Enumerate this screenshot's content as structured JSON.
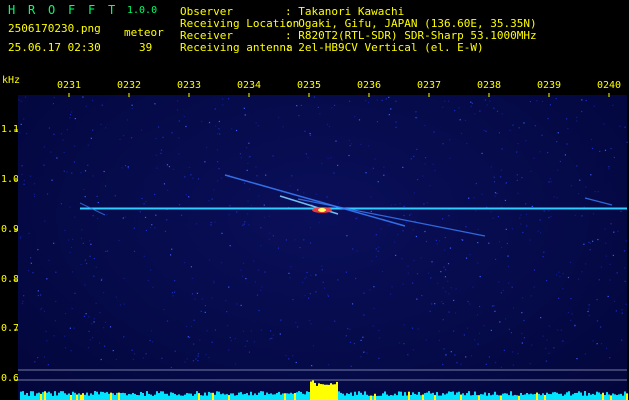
{
  "app": {
    "title_letters": [
      "H",
      "R",
      "O",
      "F",
      "F",
      "T"
    ],
    "version": "1.0.0"
  },
  "file": {
    "name": "2506170230.png",
    "datetime": "25.06.17 02:30"
  },
  "meteor": {
    "label": "meteor",
    "count": "39"
  },
  "info": [
    {
      "label": "Observer",
      "value": ": Takanori Kawachi"
    },
    {
      "label": "Receiving Location",
      "value": ": Ogaki, Gifu, JAPAN (136.60E, 35.35N)"
    },
    {
      "label": "Receiver",
      "value": ": R820T2(RTL-SDR) SDR-Sharp 53.1000MHz"
    },
    {
      "label": "Receiving antenna",
      "value": ": 2el-HB9CV Vertical (el. E-W)"
    }
  ],
  "axis": {
    "unit": "kHz",
    "time_ticks": [
      "0231",
      "0232",
      "0233",
      "0234",
      "0235",
      "0236",
      "0237",
      "0238",
      "0239",
      "0240"
    ],
    "freq_ticks": [
      "1.1",
      "1.0",
      "0.9",
      "0.8",
      "0.7",
      "0.6"
    ]
  },
  "colors": {
    "text": "#ffff00",
    "title": "#00ff66",
    "carrier": "#33ccff",
    "background": "#050a48",
    "noise_floor": "#00e5ff",
    "burst": "#ffff00"
  }
}
